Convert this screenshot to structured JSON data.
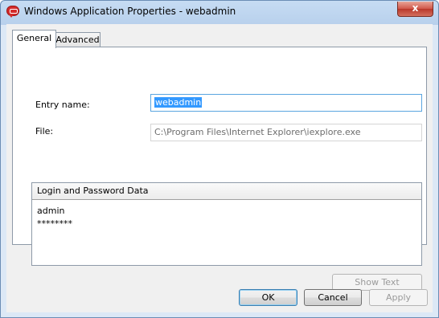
{
  "window": {
    "title": "Windows Application Properties - webadmin",
    "close_glyph": "x"
  },
  "tabs": [
    {
      "label": "General",
      "selected": true
    },
    {
      "label": "Advanced",
      "selected": false
    }
  ],
  "form": {
    "entry_label": "Entry name:",
    "entry_value": "webadmin",
    "file_label": "File:",
    "file_value": "C:\\Program Files\\Internet Explorer\\iexplore.exe"
  },
  "credentials": {
    "header": "Login and Password Data",
    "username": "admin",
    "password_masked": "********"
  },
  "buttons": {
    "show_text": "Show Text",
    "ok": "OK",
    "cancel": "Cancel",
    "apply": "Apply"
  },
  "colors": {
    "selection": "#3399ff",
    "default_button_border": "#3c7fb1"
  }
}
